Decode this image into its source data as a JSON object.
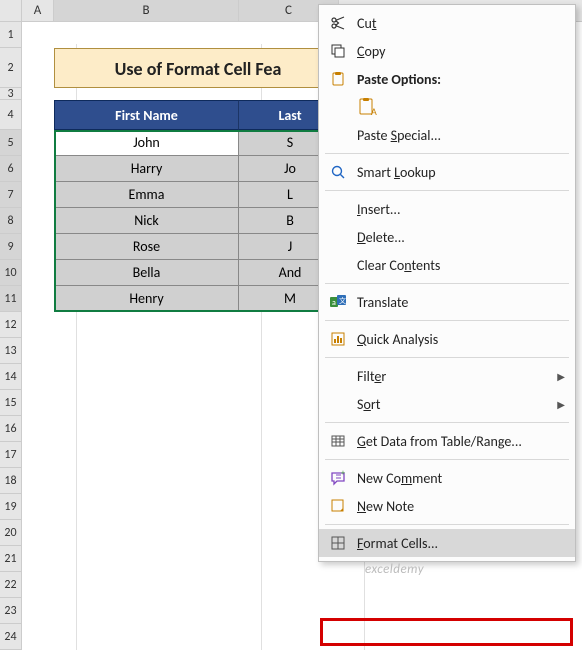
{
  "columns": {
    "A": "A",
    "B": "B",
    "C": "C"
  },
  "rows": [
    "1",
    "2",
    "3",
    "4",
    "5",
    "6",
    "7",
    "8",
    "9",
    "10",
    "11",
    "12",
    "13",
    "14",
    "15",
    "16",
    "17",
    "18",
    "19",
    "20",
    "21",
    "22",
    "23",
    "24"
  ],
  "banner": {
    "title": "Use of Format Cell Fea"
  },
  "table": {
    "headers": {
      "first": "First Name",
      "last": "Last"
    },
    "rows": [
      {
        "first": "John",
        "last": "S"
      },
      {
        "first": "Harry",
        "last": "Jo"
      },
      {
        "first": "Emma",
        "last": "L"
      },
      {
        "first": "Nick",
        "last": "B"
      },
      {
        "first": "Rose",
        "last": "J"
      },
      {
        "first": "Bella",
        "last": "And"
      },
      {
        "first": "Henry",
        "last": "M"
      }
    ]
  },
  "menu": {
    "cut": "Cut",
    "copy": "Copy",
    "paste_options": "Paste Options:",
    "paste_special": "Paste Special...",
    "smart_lookup": "Smart Lookup",
    "insert": "Insert...",
    "delete": "Delete...",
    "clear_contents": "Clear Contents",
    "translate": "Translate",
    "quick_analysis": "Quick Analysis",
    "filter": "Filter",
    "sort": "Sort",
    "get_data": "Get Data from Table/Range...",
    "new_comment": "New Comment",
    "new_note": "New Note",
    "format_cells": "Format Cells..."
  },
  "watermark": "exceldemy"
}
